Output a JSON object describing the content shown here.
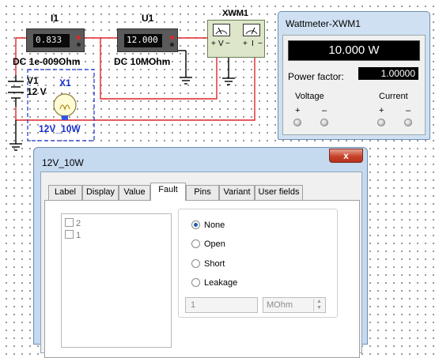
{
  "schematic": {
    "ammeter": {
      "ref": "I1",
      "reading": "0.833",
      "spec": "DC  1e-009Ohm"
    },
    "voltmeter": {
      "ref": "U1",
      "reading": "12.000",
      "spec": "DC  10MOhm"
    },
    "wattmeter_symbol": {
      "ref": "XWM1",
      "v_label": "V",
      "i_label": "I"
    },
    "battery": {
      "ref": "V1",
      "value": "12 V"
    },
    "lamp": {
      "ref": "X1",
      "value": "12V_10W"
    }
  },
  "wattmeter_window": {
    "title": "Wattmeter-XWM1",
    "power_display": "10.000 W",
    "power_factor_label": "Power factor:",
    "power_factor_value": "1.00000",
    "voltage_label": "Voltage",
    "current_label": "Current",
    "plus": "+",
    "minus": "–"
  },
  "dialog": {
    "title": "12V_10W",
    "close_glyph": "x",
    "tabs": [
      "Label",
      "Display",
      "Value",
      "Fault",
      "Pins",
      "Variant",
      "User fields"
    ],
    "active_tab": "Fault",
    "pins": [
      "2",
      "1"
    ],
    "fault_options": [
      "None",
      "Open",
      "Short",
      "Leakage"
    ],
    "selected_fault": "None",
    "leakage_value": "1",
    "leakage_unit": "MOhm"
  },
  "colors": {
    "wire": "#e0262a",
    "lamp_outline": "#1a2fd0",
    "titlebar": "#c5d9ef"
  }
}
